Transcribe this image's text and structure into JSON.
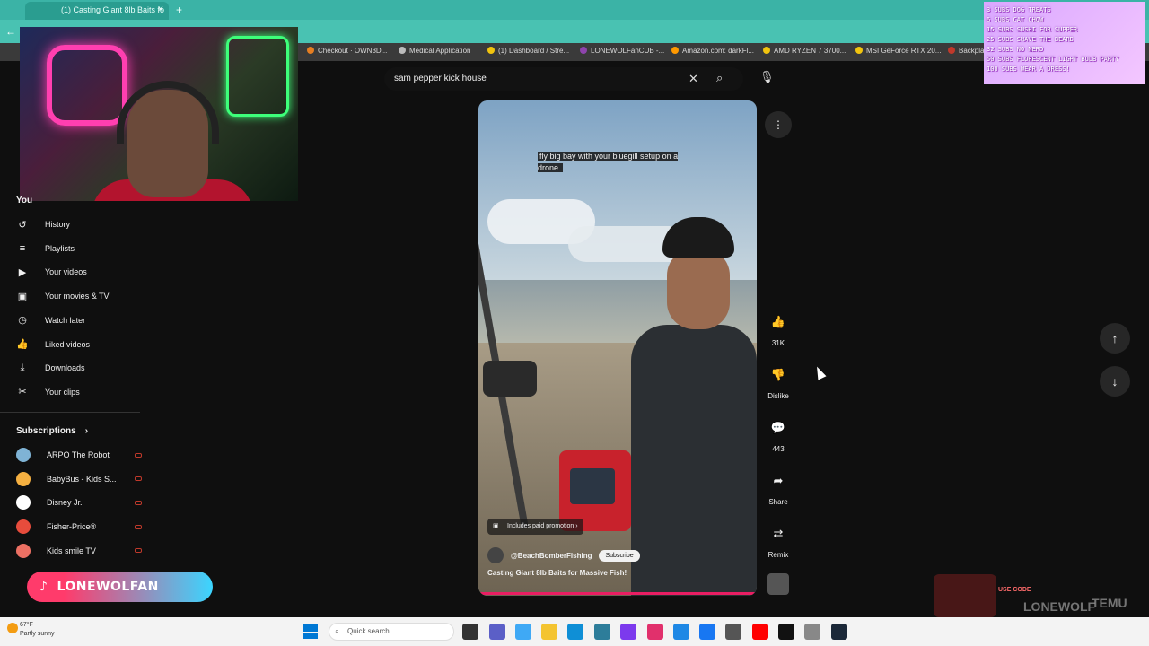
{
  "browser": {
    "tab_title": "(1) Casting Giant 8lb Baits fo",
    "bookmarks": [
      {
        "label": "Checkout · OWN3D...",
        "color": "#e67e22"
      },
      {
        "label": "Medical Application",
        "color": "#bbbbbb"
      },
      {
        "label": "(1) Dashboard / Stre...",
        "color": "#f1c40f"
      },
      {
        "label": "LONEWOLFanCUB -...",
        "color": "#8e44ad"
      },
      {
        "label": "Amazon.com: darkFl...",
        "color": "#ff9900"
      },
      {
        "label": "AMD RYZEN 7 3700...",
        "color": "#f1c40f"
      },
      {
        "label": "MSI GeForce RTX 20...",
        "color": "#f1c40f"
      },
      {
        "label": "Backplat",
        "color": "#c0392b"
      }
    ]
  },
  "search": {
    "query": "sam pepper kick house"
  },
  "sidebar": {
    "you_label": "You",
    "items": [
      {
        "label": "History",
        "icon": "↺"
      },
      {
        "label": "Playlists",
        "icon": "≡"
      },
      {
        "label": "Your videos",
        "icon": "▶"
      },
      {
        "label": "Your movies & TV",
        "icon": "▣"
      },
      {
        "label": "Watch later",
        "icon": "◷"
      },
      {
        "label": "Liked videos",
        "icon": "👍"
      },
      {
        "label": "Downloads",
        "icon": "⤓"
      },
      {
        "label": "Your clips",
        "icon": "✂"
      }
    ],
    "subscriptions_label": "Subscriptions",
    "subscriptions": [
      {
        "name": "ARPO The Robot",
        "color": "#7fb3d5"
      },
      {
        "name": "BabyBus - Kids S...",
        "color": "#f5b041"
      },
      {
        "name": "Disney Jr.",
        "color": "#ffffff"
      },
      {
        "name": "Fisher-Price®",
        "color": "#e74c3c"
      },
      {
        "name": "Kids smile TV",
        "color": "#ec7063"
      }
    ]
  },
  "video": {
    "caption": "fly big bay with your bluegill setup on a drone.",
    "promo": "Includes paid promotion",
    "channel": "@BeachBomberFishing",
    "subscribe": "Subscribe",
    "title": "Casting Giant 8lb Baits for Massive Fish!"
  },
  "actions": {
    "like_count": "31K",
    "dislike_label": "Dislike",
    "comment_count": "443",
    "share_label": "Share",
    "remix_label": "Remix"
  },
  "overlays": {
    "goals": [
      "3 SUBS DOG TREATS",
      "6 SUBS CAT CHOW",
      "15 SUBS SUSHI FOR SUPPER",
      "25 SUBS SHAVE THE BEARD",
      "32 SUBS NO NERD",
      "50 SUBS FLORESCENT LIGHT BULB PARTY",
      "100 SUBS WEAR A DRESS!"
    ],
    "tiktok_handle": "LONEWOLFAN",
    "promo_badge": "USE CODE",
    "promo_code": "LONEWOLF",
    "promo_brand": "TEMU"
  },
  "taskbar": {
    "temperature": "67°F",
    "weather": "Partly sunny",
    "search_placeholder": "Quick search"
  }
}
